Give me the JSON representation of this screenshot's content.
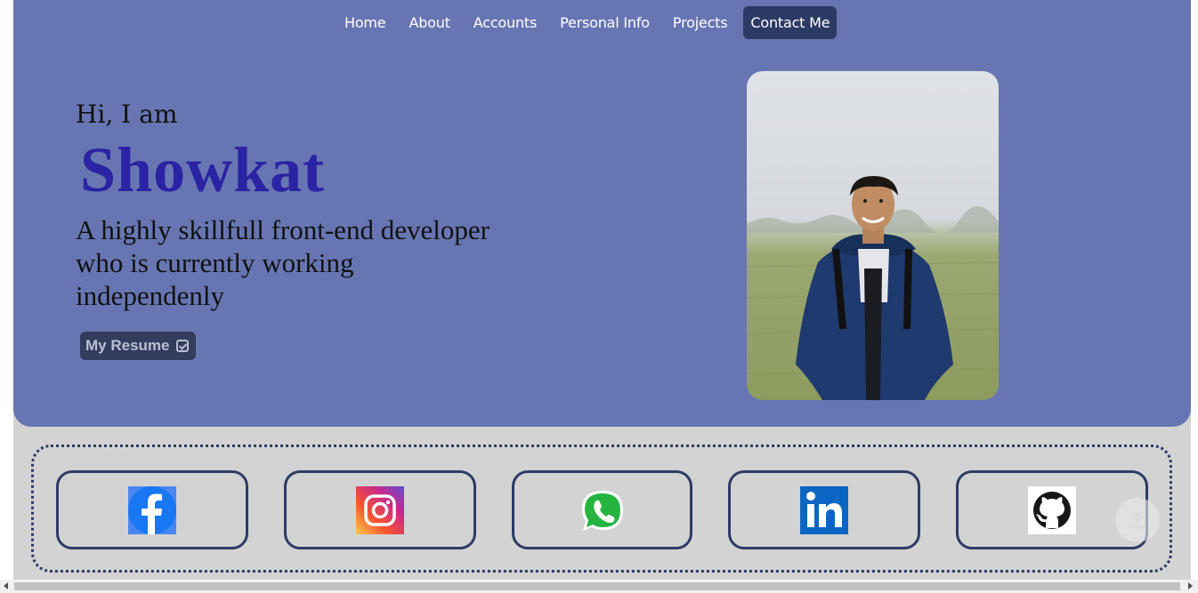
{
  "nav": {
    "items": [
      {
        "label": "Home"
      },
      {
        "label": "About"
      },
      {
        "label": "Accounts"
      },
      {
        "label": "Personal Info"
      },
      {
        "label": "Projects"
      },
      {
        "label": "Contact Me",
        "active": true
      }
    ]
  },
  "hero": {
    "greeting": "Hi, I am",
    "name": "Showkat",
    "tagline": "A highly skillfull front-end developer who is currently working independenly",
    "resume_label": "My Resume",
    "resume_icon": "checkbox-icon",
    "photo": "profile-photo"
  },
  "social": {
    "items": [
      {
        "icon": "facebook-icon"
      },
      {
        "icon": "instagram-icon"
      },
      {
        "icon": "whatsapp-icon"
      },
      {
        "icon": "linkedin-icon"
      },
      {
        "icon": "github-icon"
      }
    ]
  },
  "scroll_top_icon": "upload-arrow-icon",
  "colors": {
    "hero_bg": "#6776b2",
    "page_bg": "#d3d3d3",
    "accent_dark": "#2c3a66",
    "name_color": "#2a23a3"
  }
}
